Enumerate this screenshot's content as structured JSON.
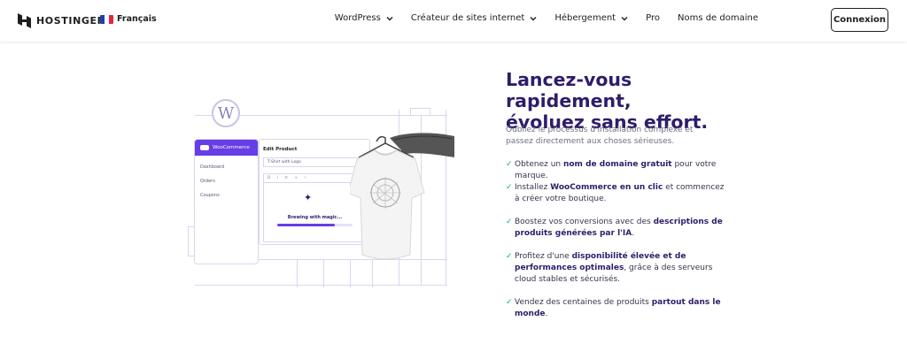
{
  "header": {
    "logo_text": "HOSTINGER",
    "language": "Français",
    "nav": [
      "WordPress",
      "Créateur de sites internet",
      "Hébergement",
      "Pro",
      "Noms de domaine"
    ],
    "login_label": "Connexion"
  },
  "illustration": {
    "sidebar_header": "WooCommerce",
    "sidebar_items": [
      "Dashboard",
      "Orders",
      "Coupons"
    ],
    "edit_product": "Edit Product",
    "product_name": "T-Shirt with Logo",
    "brewing_text": "Brewing with magic...",
    "progress": 0.76,
    "accent": "#673de6"
  },
  "hero": {
    "title_line1": "Lancez-vous rapidement,",
    "title_line2": "évoluez sans effort.",
    "subtitle": "Oubliez le processus d'installation complexe et passez directement aux choses sérieuses."
  },
  "features": [
    {
      "pre": "Obtenez un ",
      "bold": "nom de domaine gratuit",
      "post": " pour votre marque."
    },
    {
      "pre": "Installez ",
      "bold": "WooCommerce en un clic",
      "post": " et commencez à créer votre boutique."
    },
    {
      "pre": "Boostez vos conversions avec des ",
      "bold": "descriptions de produits générées par l'IA",
      "post": "."
    },
    {
      "pre": "Profitez d'une ",
      "bold": "disponibilité élevée et de performances optimales",
      "post": ", grâce à des serveurs cloud stables et sécurisés."
    },
    {
      "pre": "Vendez des centaines de produits ",
      "bold": "partout dans le monde",
      "post": "."
    }
  ],
  "colors": {
    "brand_dark": "#2f1c6a",
    "check": "#00b090"
  }
}
